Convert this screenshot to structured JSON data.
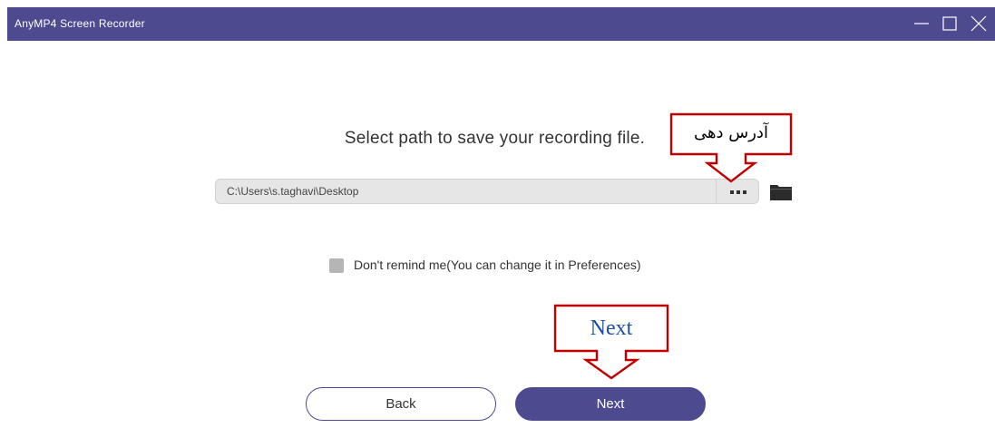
{
  "window": {
    "title": "AnyMP4 Screen Recorder",
    "accent_color": "#4d4a8f",
    "controls": [
      "minimize-icon",
      "maximize-icon",
      "close-icon"
    ]
  },
  "main": {
    "prompt": "Select path to save your recording file.",
    "path_value": "C:\\Users\\s.taghavi\\Desktop",
    "browse_button_icon": "ellipsis-icon",
    "folder_button_icon": "folder-icon",
    "remind_checkbox_checked": false,
    "remind_label": "Don't remind me(You can change it in Preferences)"
  },
  "buttons": {
    "back_label": "Back",
    "next_label": "Next"
  },
  "annotations": {
    "browse_callout_text": "آدرس دهی",
    "next_callout_text": "Next",
    "callout_border_color": "#c00000"
  }
}
